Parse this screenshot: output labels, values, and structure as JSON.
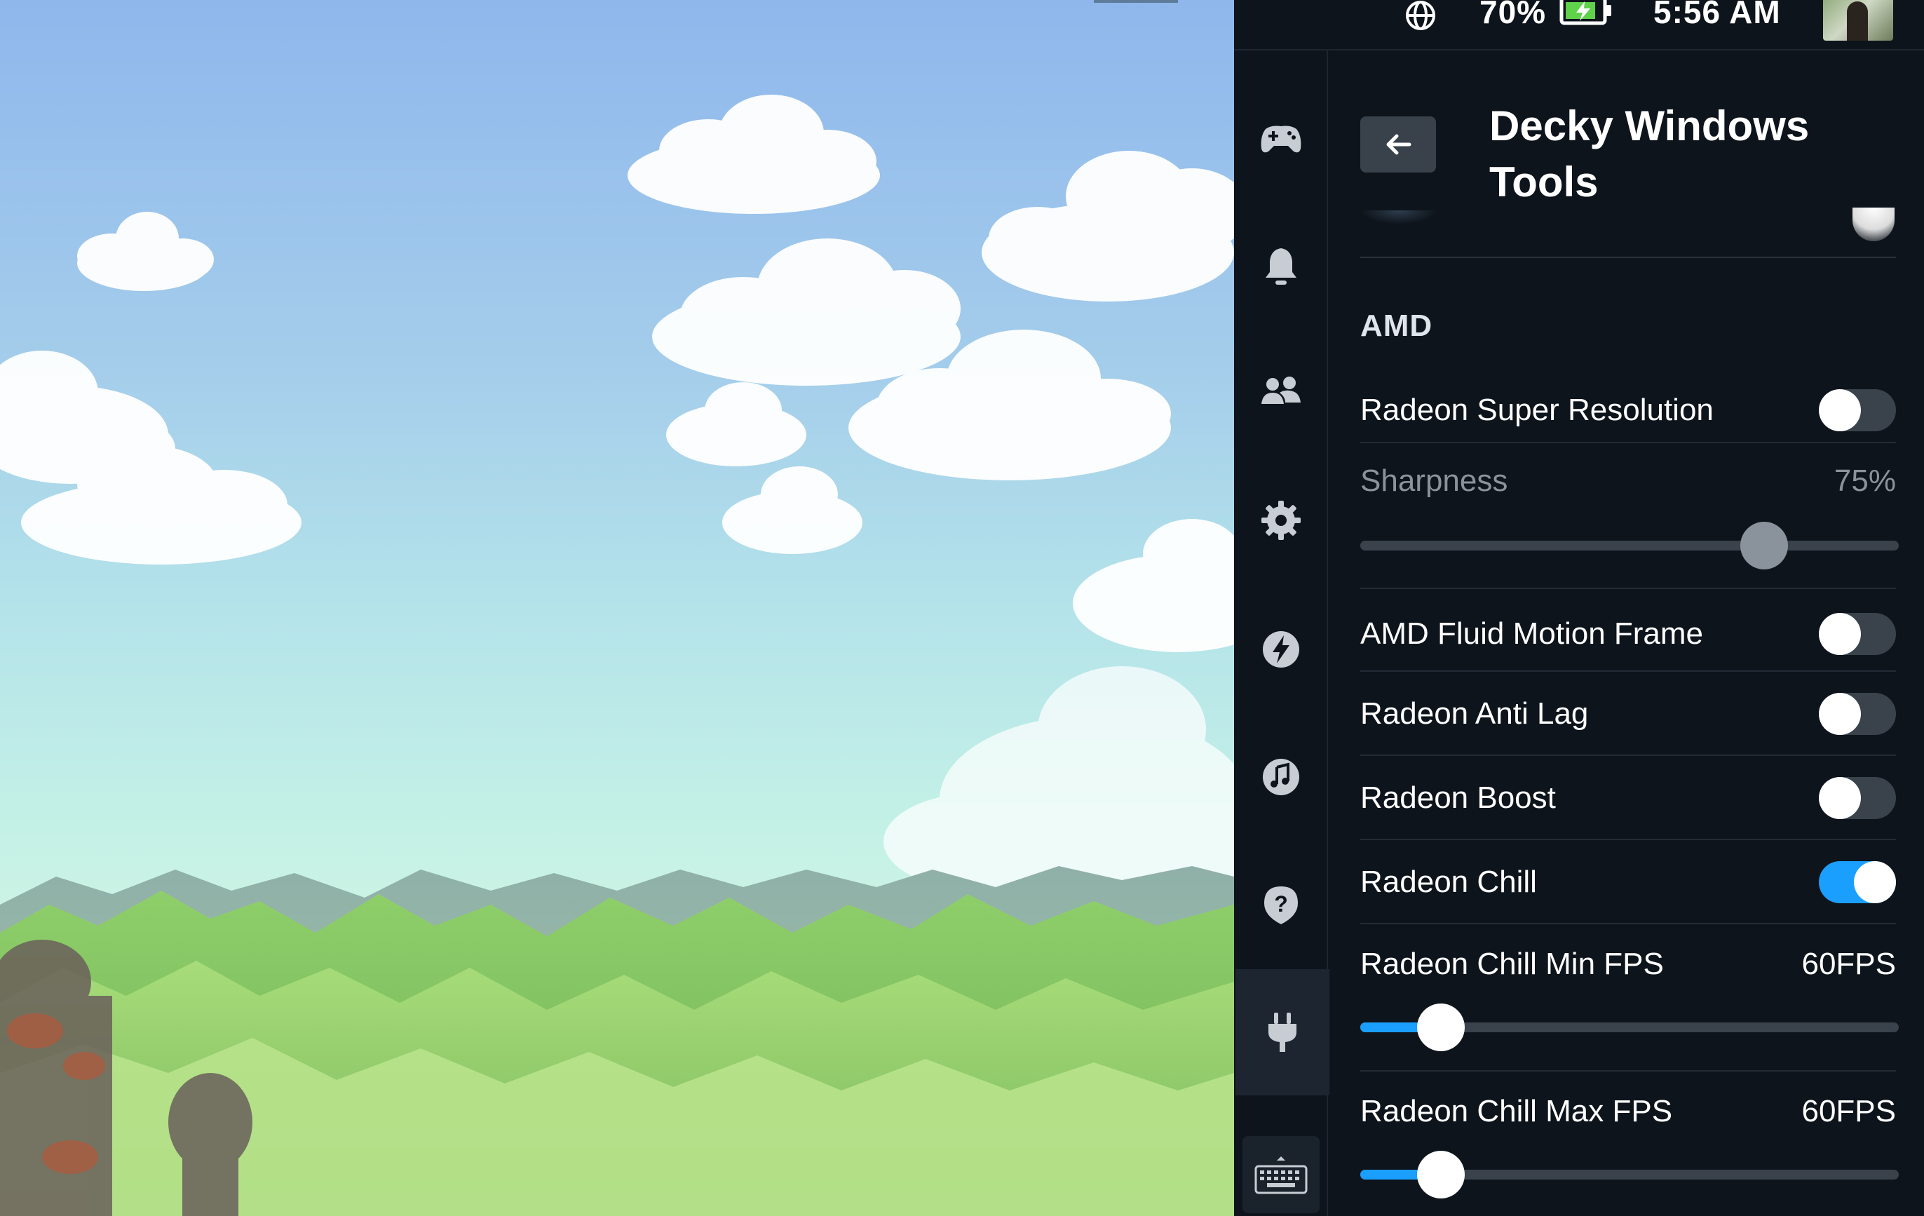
{
  "status_bar": {
    "battery_percent": "70%",
    "time": "5:56 AM",
    "icons": [
      "globe-icon",
      "battery-charging-icon"
    ]
  },
  "nav_rail": {
    "items": [
      {
        "icon": "gamepad-icon",
        "active": false
      },
      {
        "icon": "bell-icon",
        "active": false
      },
      {
        "icon": "friends-icon",
        "active": false
      },
      {
        "icon": "gear-icon",
        "active": false
      },
      {
        "icon": "lightning-icon",
        "active": false
      },
      {
        "icon": "music-icon",
        "active": false
      },
      {
        "icon": "help-icon",
        "active": false
      },
      {
        "icon": "plug-icon",
        "active": true
      }
    ],
    "bottom_icon": "keyboard-icon"
  },
  "panel": {
    "title": "Decky Windows Tools",
    "back_icon": "back-arrow-icon",
    "section": "AMD",
    "settings": {
      "rsr": {
        "label": "Radeon Super Resolution",
        "on": false
      },
      "sharpness": {
        "label": "Sharpness",
        "value": "75%",
        "level": 0.75,
        "disabled": true
      },
      "afmf": {
        "label": "AMD Fluid Motion Frame",
        "on": false
      },
      "anti_lag": {
        "label": "Radeon Anti Lag",
        "on": false
      },
      "boost": {
        "label": "Radeon Boost",
        "on": false
      },
      "chill": {
        "label": "Radeon Chill",
        "on": true
      },
      "chill_min": {
        "label": "Radeon Chill Min FPS",
        "value": "60FPS",
        "level": 0.15
      },
      "chill_max": {
        "label": "Radeon Chill Max FPS",
        "value": "60FPS",
        "level": 0.15
      }
    }
  },
  "colors": {
    "accent": "#1a9fff",
    "panel_bg": "#0e141b",
    "toggle_off": "#3a424c"
  }
}
